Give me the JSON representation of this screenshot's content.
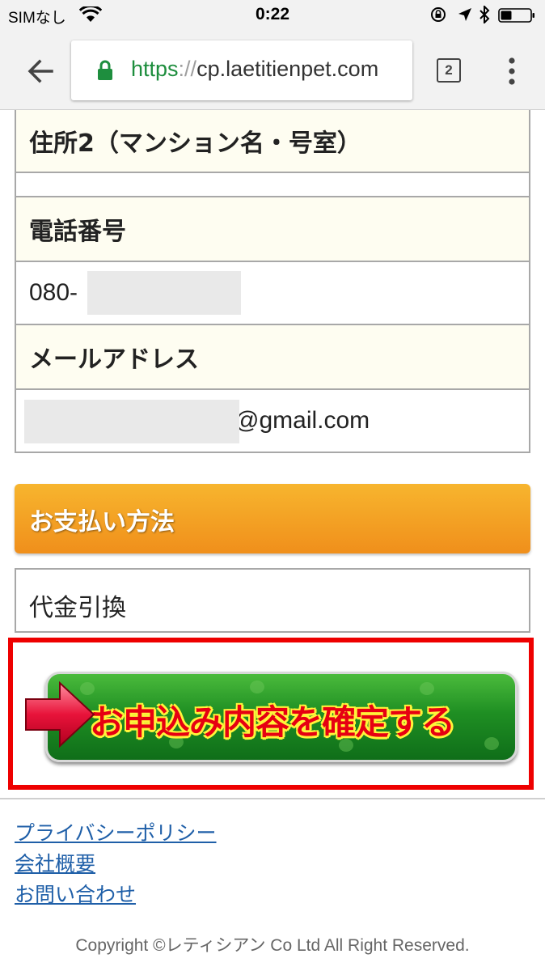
{
  "status_bar": {
    "carrier": "SIMなし",
    "time": "0:22"
  },
  "browser": {
    "url_scheme": "https",
    "url_separator": "://",
    "url_host": "cp.laetitienpet.com",
    "tab_count": "2"
  },
  "form": {
    "address2_label": "住所2（マンション名・号室）",
    "address2_value": "",
    "phone_label": "電話番号",
    "phone_value": "080-",
    "email_label": "メールアドレス",
    "email_value": "@gmail.com"
  },
  "payment": {
    "header": "お支払い方法",
    "method": "代金引換"
  },
  "confirm": {
    "label": "お申込み内容を確定する"
  },
  "footer": {
    "links": [
      "プライバシーポリシー",
      "会社概要",
      "お問い合わせ"
    ],
    "copyright": "Copyright ©レティシアン Co Ltd All Right Reserved."
  },
  "colors": {
    "accent_orange": "#f39c1f",
    "confirm_green": "#1f8f23",
    "highlight_red": "#ee0000",
    "link_blue": "#1f5fa8"
  }
}
